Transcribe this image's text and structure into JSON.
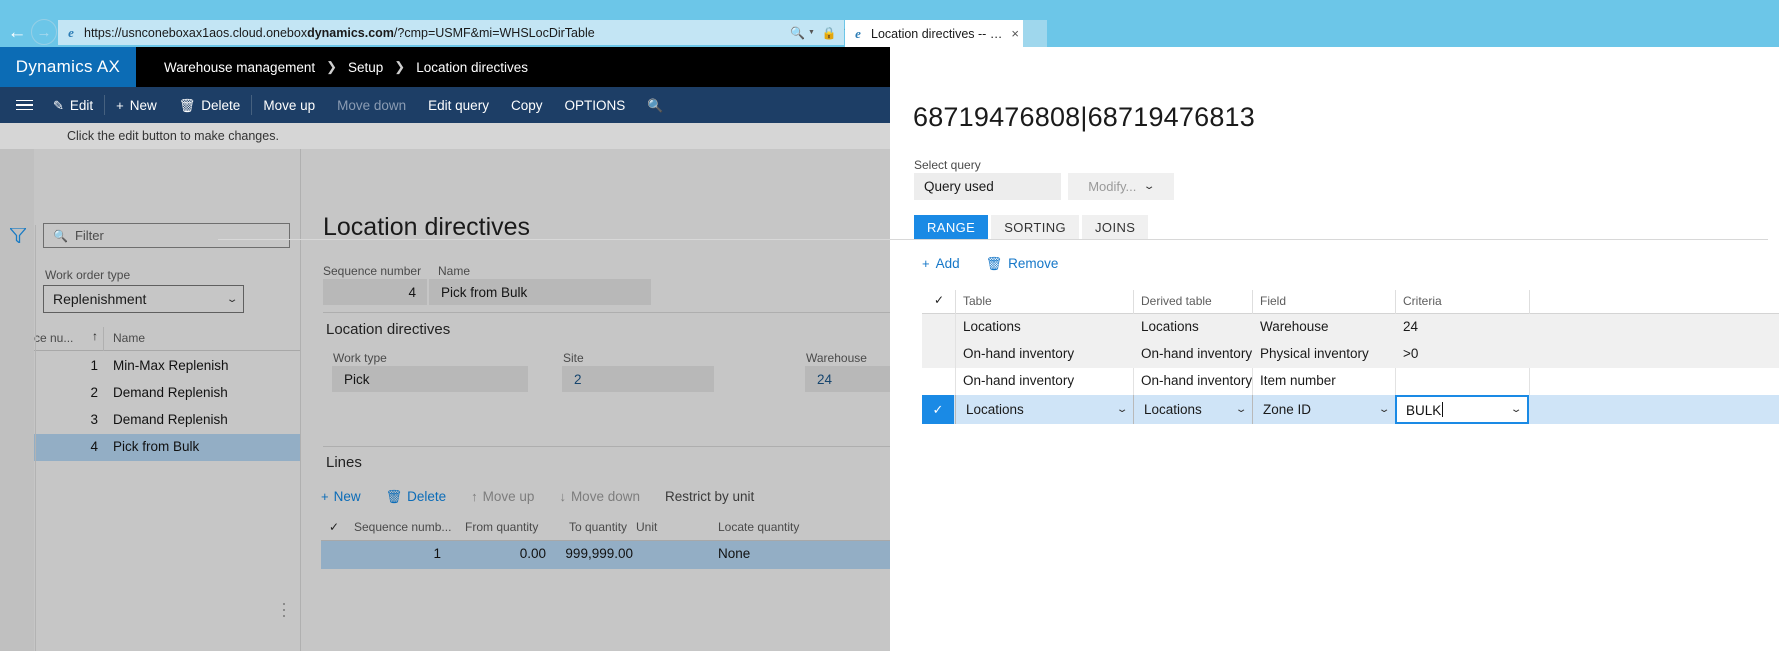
{
  "browser": {
    "url_prefix": "https://usnconeboxax1aos.cloud.one",
    "url_plain_1": "https://usnconeboxax1aos.cloud.onebox",
    "url_bold": "dynamics.com",
    "url_plain_2": "/?cmp=USMF&mi=WHSLocDirTable",
    "back_icon": "back-arrow-icon",
    "forward_icon": "forward-arrow-icon",
    "search_icon": "search-icon",
    "lock_icon": "lock-icon",
    "refresh_icon": "refresh-icon",
    "tab_title": "Location directives -- Dynami...",
    "tab_close": "×"
  },
  "navbar": {
    "product": "Dynamics AX",
    "breadcrumb": [
      "Warehouse management",
      "Setup",
      "Location directives"
    ],
    "separator": "›"
  },
  "commandbar": {
    "items": [
      {
        "label": "Edit",
        "icon": "✎",
        "disabled": false
      },
      {
        "label": "New",
        "icon": "+",
        "disabled": false
      },
      {
        "label": "Delete",
        "icon": "🗑",
        "disabled": false
      },
      {
        "label": "Move up",
        "icon": "",
        "disabled": false
      },
      {
        "label": "Move down",
        "icon": "",
        "disabled": true
      },
      {
        "label": "Edit query",
        "icon": "",
        "disabled": false
      },
      {
        "label": "Copy",
        "icon": "",
        "disabled": false
      },
      {
        "label": "OPTIONS",
        "icon": "",
        "disabled": false
      }
    ],
    "search_icon": "search-icon",
    "menu_icon": "hamburger-menu-icon"
  },
  "infobar": {
    "message": "Click the edit button to make changes."
  },
  "left_pane": {
    "filter_placeholder": "Filter",
    "work_order_type_label": "Work order type",
    "work_order_type_value": "Replenishment",
    "grid_headers": {
      "sequence": "ce nu...",
      "name": "Name",
      "sort_arrow": "↑"
    },
    "rows": [
      {
        "seq": "1",
        "name": "Min-Max Replenish",
        "selected": false
      },
      {
        "seq": "2",
        "name": "Demand Replenish",
        "selected": false
      },
      {
        "seq": "3",
        "name": "Demand Replenish",
        "selected": false
      },
      {
        "seq": "4",
        "name": "Pick from Bulk",
        "selected": true
      }
    ]
  },
  "main": {
    "page_title": "Location directives",
    "sequence_number_label": "Sequence number",
    "sequence_number_value": "4",
    "name_label": "Name",
    "name_value": "Pick from Bulk",
    "section_title": "Location directives",
    "work_type_label": "Work type",
    "work_type_value": "Pick",
    "site_label": "Site",
    "site_value": "2",
    "warehouse_label": "Warehouse",
    "warehouse_value": "24",
    "lines_title": "Lines",
    "lines_toolbar": [
      {
        "label": "New",
        "icon": "+",
        "state": "link"
      },
      {
        "label": "Delete",
        "icon": "🗑",
        "state": "link"
      },
      {
        "label": "Move up",
        "icon": "↑",
        "state": "disabled"
      },
      {
        "label": "Move down",
        "icon": "↓",
        "state": "disabled"
      },
      {
        "label": "Restrict by unit",
        "icon": "",
        "state": "dark"
      }
    ],
    "lines_headers": [
      "Sequence numb...",
      "From quantity",
      "To quantity",
      "Unit",
      "Locate quantity"
    ],
    "lines_rows": [
      {
        "seq": "1",
        "from_qty": "0.00",
        "to_qty": "999,999.00",
        "unit": "",
        "locate_qty": "None"
      }
    ]
  },
  "query_panel": {
    "title": "68719476808|68719476813",
    "select_query_label": "Select query",
    "select_query_value": "Query used",
    "modify_label": "Modify...",
    "tabs": [
      {
        "label": "RANGE",
        "active": true
      },
      {
        "label": "SORTING",
        "active": false
      },
      {
        "label": "JOINS",
        "active": false
      }
    ],
    "toolbar": [
      {
        "label": "Add",
        "icon": "+"
      },
      {
        "label": "Remove",
        "icon": "🗑"
      }
    ],
    "grid_headers": [
      "Table",
      "Derived table",
      "Field",
      "Criteria"
    ],
    "rows": [
      {
        "checked": false,
        "table": "Locations",
        "derived_table": "Locations",
        "field": "Warehouse",
        "criteria": "24",
        "active": false
      },
      {
        "checked": false,
        "table": "On-hand inventory",
        "derived_table": "On-hand inventory",
        "field": "Physical inventory",
        "criteria": ">0",
        "active": false
      },
      {
        "checked": false,
        "table": "On-hand inventory",
        "derived_table": "On-hand inventory",
        "field": "Item number",
        "criteria": "",
        "active": false
      },
      {
        "checked": true,
        "table": "Locations",
        "derived_table": "Locations",
        "field": "Zone ID",
        "criteria": "BULK",
        "active": true
      }
    ]
  },
  "colors": {
    "accent_blue": "#1a8ae5",
    "navbar_black": "#000000",
    "cmdbar_blue": "#1d3e66",
    "logo_blue": "#0c6cb5",
    "selection_gray_blue": "#93aec5",
    "browser_chrome": "#6cc6e8"
  }
}
